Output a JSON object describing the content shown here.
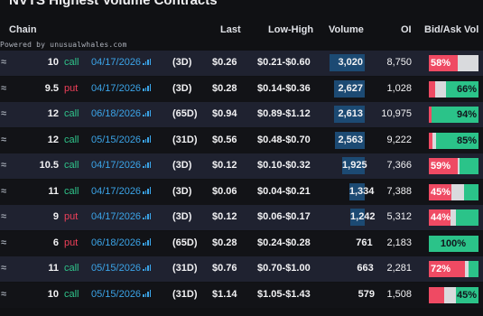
{
  "title": "NVTS  Highest Volume Contracts",
  "powered_by": "Powered by unusualwhales.com",
  "headers": {
    "chain": "Chain",
    "last": "Last",
    "low_high": "Low-High",
    "volume": "Volume",
    "oi": "OI",
    "bid_ask_vol": "Bid/Ask Vol"
  },
  "colors": {
    "call": "#2fc48b",
    "put": "#f0405a",
    "expiry": "#3ba4e8",
    "volume_bar": "#1c4a73",
    "bid": "#ef4a63",
    "ask": "#2bc389"
  },
  "rows": [
    {
      "strike": "10",
      "type": "call",
      "expiry": "04/17/2026",
      "dte": "(3D)",
      "last": "$0.26",
      "low_high": "$0.21-$0.60",
      "volume": "3,020",
      "vol_fraction": 1.0,
      "oi": "8,750",
      "bid_pct": 58,
      "ask_pct": 0,
      "label": "58%",
      "label_side": "bid"
    },
    {
      "strike": "9.5",
      "type": "put",
      "expiry": "04/17/2026",
      "dte": "(3D)",
      "last": "$0.28",
      "low_high": "$0.14-$0.36",
      "volume": "2,627",
      "vol_fraction": 0.87,
      "oi": "1,028",
      "bid_pct": 12,
      "ask_pct": 66,
      "label": "66%",
      "label_side": "ask"
    },
    {
      "strike": "12",
      "type": "call",
      "expiry": "06/18/2026",
      "dte": "(65D)",
      "last": "$0.94",
      "low_high": "$0.89-$1.12",
      "volume": "2,613",
      "vol_fraction": 0.87,
      "oi": "10,975",
      "bid_pct": 6,
      "ask_pct": 94,
      "label": "94%",
      "label_side": "ask"
    },
    {
      "strike": "12",
      "type": "call",
      "expiry": "05/15/2026",
      "dte": "(31D)",
      "last": "$0.56",
      "low_high": "$0.48-$0.70",
      "volume": "2,563",
      "vol_fraction": 0.85,
      "oi": "9,222",
      "bid_pct": 8,
      "ask_pct": 85,
      "label": "85%",
      "label_side": "ask"
    },
    {
      "strike": "10.5",
      "type": "call",
      "expiry": "04/17/2026",
      "dte": "(3D)",
      "last": "$0.12",
      "low_high": "$0.10-$0.32",
      "volume": "1,925",
      "vol_fraction": 0.64,
      "oi": "7,366",
      "bid_pct": 59,
      "ask_pct": 38,
      "label": "59%",
      "label_side": "bid"
    },
    {
      "strike": "11",
      "type": "call",
      "expiry": "04/17/2026",
      "dte": "(3D)",
      "last": "$0.06",
      "low_high": "$0.04-$0.21",
      "volume": "1,334",
      "vol_fraction": 0.44,
      "oi": "7,388",
      "bid_pct": 45,
      "ask_pct": 30,
      "label": "45%",
      "label_side": "bid"
    },
    {
      "strike": "9",
      "type": "put",
      "expiry": "04/17/2026",
      "dte": "(3D)",
      "last": "$0.12",
      "low_high": "$0.06-$0.17",
      "volume": "1,242",
      "vol_fraction": 0.41,
      "oi": "5,312",
      "bid_pct": 44,
      "ask_pct": 45,
      "label": "44%",
      "label_side": "bid"
    },
    {
      "strike": "6",
      "type": "put",
      "expiry": "06/18/2026",
      "dte": "(65D)",
      "last": "$0.28",
      "low_high": "$0.24-$0.28",
      "volume": "761",
      "vol_fraction": 0.25,
      "oi": "2,183",
      "bid_pct": 0,
      "ask_pct": 100,
      "label": "100%",
      "label_side": "ask"
    },
    {
      "strike": "11",
      "type": "call",
      "expiry": "05/15/2026",
      "dte": "(31D)",
      "last": "$0.76",
      "low_high": "$0.70-$1.00",
      "volume": "663",
      "vol_fraction": 0.22,
      "oi": "2,281",
      "bid_pct": 72,
      "ask_pct": 20,
      "label": "72%",
      "label_side": "bid"
    },
    {
      "strike": "10",
      "type": "call",
      "expiry": "05/15/2026",
      "dte": "(31D)",
      "last": "$1.14",
      "low_high": "$1.05-$1.43",
      "volume": "579",
      "vol_fraction": 0.19,
      "oi": "1,508",
      "bid_pct": 30,
      "ask_pct": 45,
      "label": "45%",
      "label_side": "ask"
    }
  ]
}
